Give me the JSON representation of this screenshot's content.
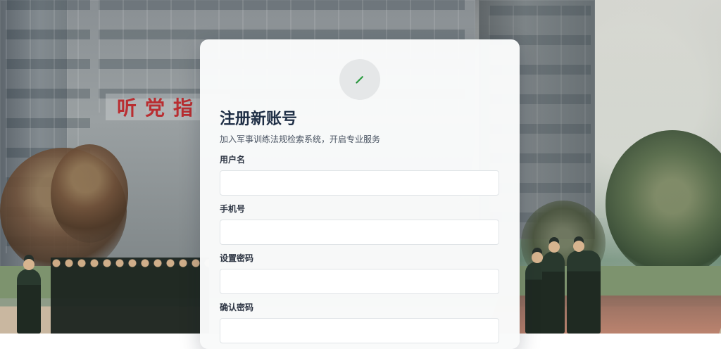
{
  "background": {
    "sign_text": "听党指"
  },
  "register": {
    "logo_icon": "pen-icon",
    "title": "注册新账号",
    "subtitle": "加入军事训练法规检索系统，开启专业服务",
    "fields": {
      "username": {
        "label": "用户名",
        "value": "",
        "placeholder": ""
      },
      "phone": {
        "label": "手机号",
        "value": "",
        "placeholder": ""
      },
      "password": {
        "label": "设置密码",
        "value": "",
        "placeholder": ""
      },
      "confirm_password": {
        "label": "确认密码",
        "value": "",
        "placeholder": ""
      }
    }
  },
  "colors": {
    "title": "#1f2f46",
    "icon_green": "#2f9e44",
    "card_background": "#f9fafa"
  }
}
